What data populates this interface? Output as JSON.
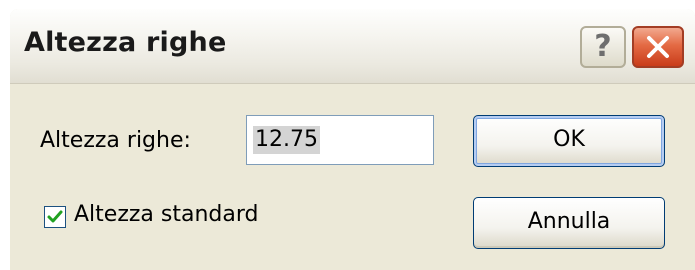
{
  "dialog": {
    "title": "Altezza righe",
    "help_glyph": "?",
    "icons": {
      "help": "help-icon",
      "close": "close-icon"
    }
  },
  "form": {
    "row_height_label": "Altezza righe:",
    "row_height_value": "12.75",
    "standard_height_label": "Altezza standard",
    "standard_height_checked": true
  },
  "buttons": {
    "ok_label": "OK",
    "cancel_label": "Annulla"
  },
  "colors": {
    "dialog_face": "#ece9d8",
    "close_button": "#d9502b",
    "checkmark": "#21a121",
    "default_button_border": "#003c74"
  }
}
